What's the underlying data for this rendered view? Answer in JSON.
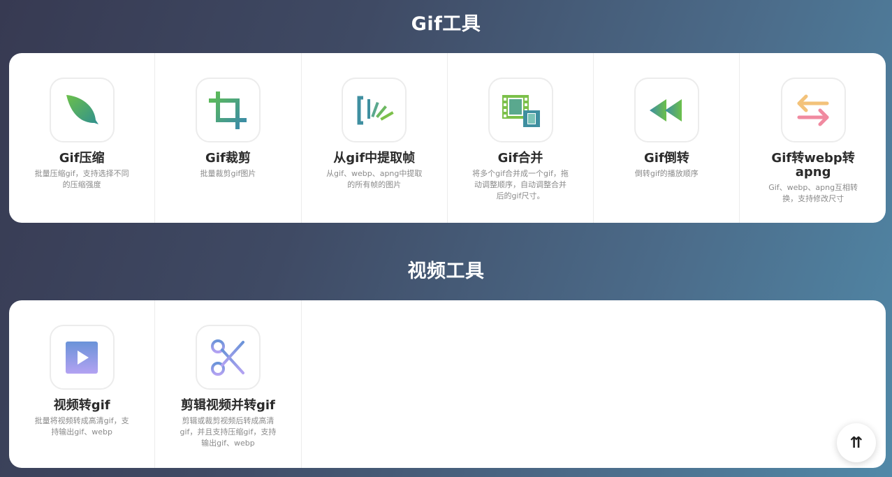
{
  "sections": [
    {
      "title": "Gif工具",
      "tools": [
        {
          "name": "Gif压缩",
          "desc": "批量压缩gif，支持选择不同的压缩强度",
          "icon": "leaf-icon"
        },
        {
          "name": "Gif裁剪",
          "desc": "批量裁剪gif图片",
          "icon": "crop-icon"
        },
        {
          "name": "从gif中提取帧",
          "desc": "从gif、webp、apng中提取的所有帧的图片",
          "icon": "frames-extract-icon"
        },
        {
          "name": "Gif合并",
          "desc": "将多个gif合并成一个gif，拖动调整顺序，自动调整合并后的gif尺寸。",
          "icon": "film-merge-icon"
        },
        {
          "name": "Gif倒转",
          "desc": "倒转gif的播放顺序",
          "icon": "rewind-icon"
        },
        {
          "name": "Gif转webp转apng",
          "desc": "Gif、webp、apng互相转换，支持修改尺寸",
          "icon": "swap-arrows-icon"
        }
      ]
    },
    {
      "title": "视频工具",
      "tools": [
        {
          "name": "视频转gif",
          "desc": "批量将视频转成高清gif，支持输出gif、webp",
          "icon": "video-play-icon"
        },
        {
          "name": "剪辑视频并转gif",
          "desc": "剪辑或裁剪视频后转成高清gif，并且支持压缩gif，支持输出gif、webp",
          "icon": "scissors-icon"
        }
      ]
    }
  ],
  "back_to_top": {
    "label": "⇈",
    "icon": "back-to-top-icon"
  },
  "colors": {
    "green": "#5bb85c",
    "teal": "#3f8fa0",
    "pink": "#f08aa0",
    "orange": "#f3c27a",
    "purple": "#a49bf0",
    "blue": "#6a93d8"
  }
}
